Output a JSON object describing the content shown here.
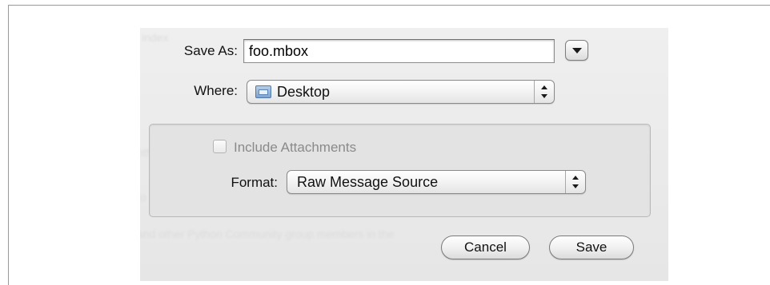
{
  "dialog": {
    "save_as_label": "Save As:",
    "save_as_value": "foo.mbox",
    "where_label": "Where:",
    "where_value": "Desktop",
    "include_attachments_label": "Include Attachments",
    "include_attachments_checked": false,
    "format_label": "Format:",
    "format_value": "Raw Message Source",
    "cancel_label": "Cancel",
    "save_label": "Save"
  },
  "icons": {
    "disclosure": "disclosure-triangle-icon",
    "folder": "folder-icon",
    "popup_arrows": "up-down-arrows-icon"
  }
}
